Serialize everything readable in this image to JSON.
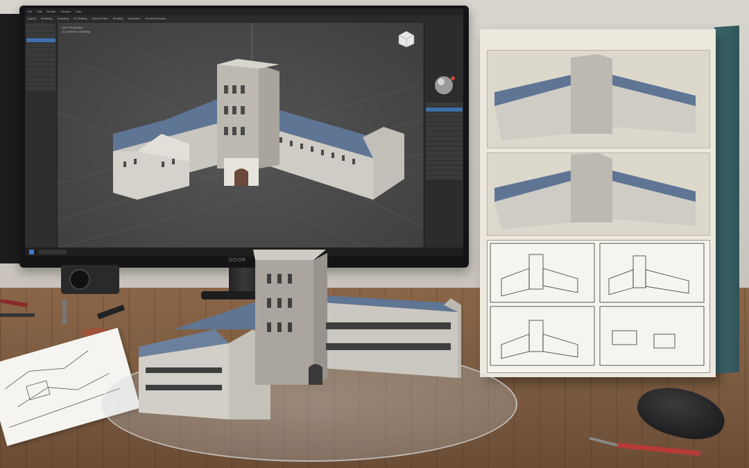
{
  "scene": {
    "description_free": true
  },
  "monitor": {
    "brand_label": "DOOR"
  },
  "app": {
    "menu_items": [
      "File",
      "Edit",
      "Render",
      "Window",
      "Help",
      "Layout",
      "Modeling",
      "Sculpting",
      "UV Editing",
      "Texture Paint",
      "Shading",
      "Animation",
      "Geometry Nodes"
    ],
    "viewport_overlay": [
      "User Perspective",
      "(1) Collection | Building"
    ],
    "outliner_rows": 14,
    "props_rows": 16
  },
  "colors": {
    "roof": "#5f7594",
    "wall": "#c9c6bf",
    "tower": "#bdb9b1",
    "accent_selection": "#3f6fa6",
    "box_side": "#3f6a70"
  },
  "icons": [
    "gizmo-cube-icon",
    "material-sphere-icon",
    "windows-start-icon"
  ]
}
